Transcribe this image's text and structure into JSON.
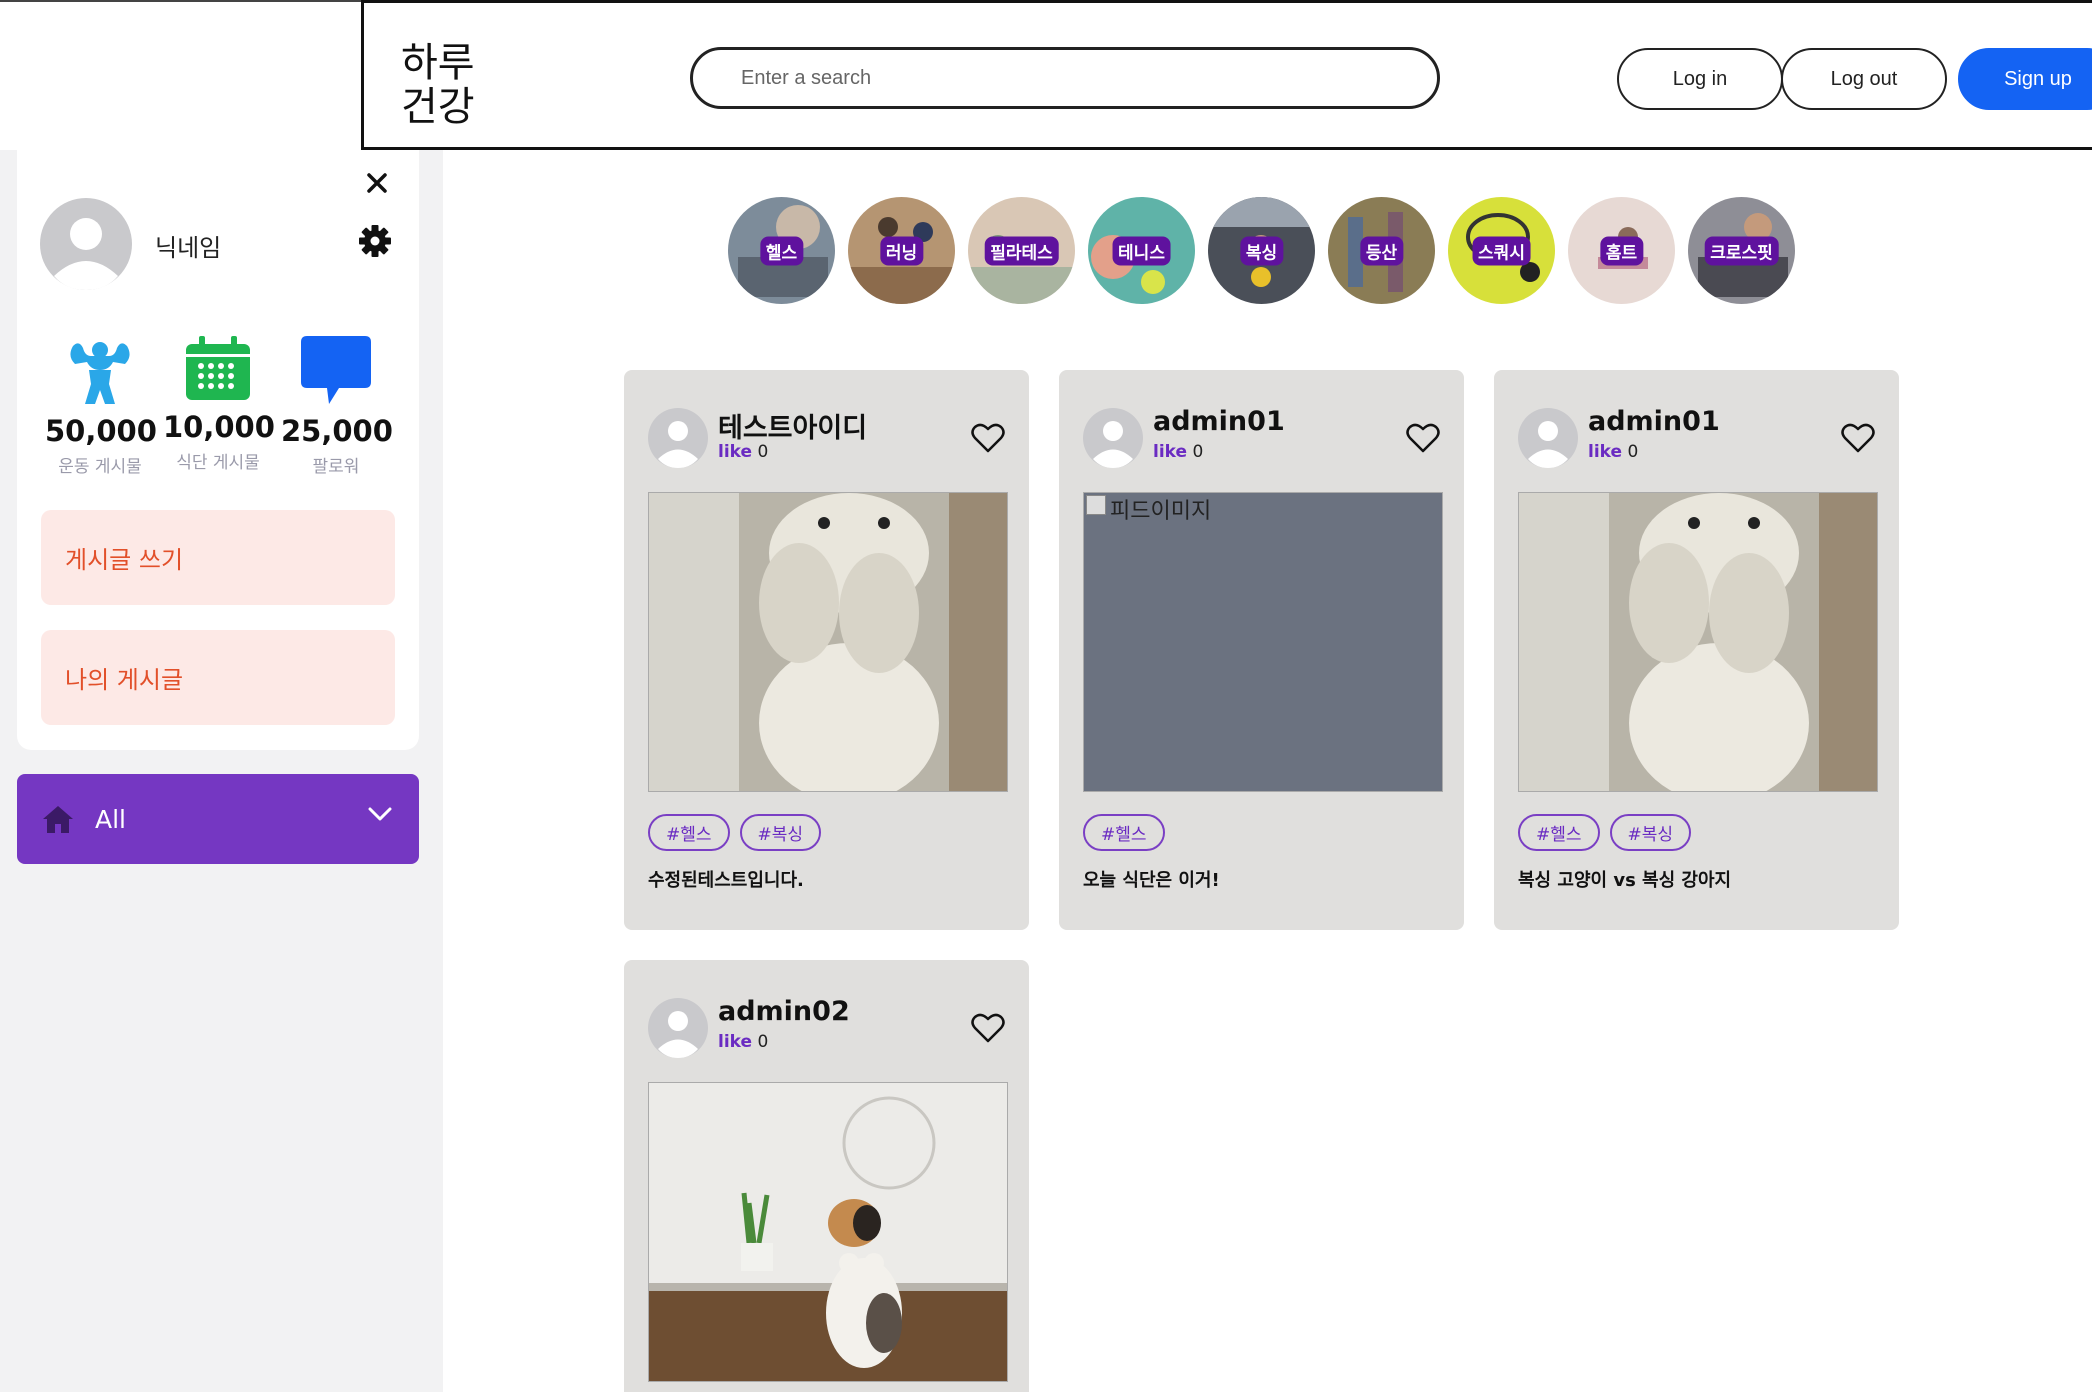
{
  "header": {
    "logo_line1": "하루",
    "logo_line2": "건강",
    "search_placeholder": "Enter a search",
    "login_label": "Log in",
    "logout_label": "Log out",
    "signup_label": "Sign up"
  },
  "profile": {
    "nickname": "닉네임",
    "stats": [
      {
        "value": "50,000",
        "label": "운동 게시물"
      },
      {
        "value": "10,000",
        "label": "식단 게시물"
      },
      {
        "value": "25,000",
        "label": "팔로워"
      }
    ],
    "write_label": "게시글 쓰기",
    "my_posts_label": "나의 게시글"
  },
  "filter": {
    "selected": "All"
  },
  "categories": [
    {
      "label": "헬스",
      "color": "#7d8c9a"
    },
    {
      "label": "러닝",
      "color": "#b59572"
    },
    {
      "label": "필라테스",
      "color": "#d9c7b5"
    },
    {
      "label": "테니스",
      "color": "#5fb3a8"
    },
    {
      "label": "복싱",
      "color": "#4a4f58"
    },
    {
      "label": "등산",
      "color": "#8a7c55"
    },
    {
      "label": "스쿼시",
      "color": "#d7e03a"
    },
    {
      "label": "홈트",
      "color": "#e7d9d4"
    },
    {
      "label": "크로스핏",
      "color": "#8e8e96"
    }
  ],
  "posts": [
    {
      "user": "테스트아이디",
      "like_word": "like",
      "like_count": "0",
      "tags": [
        "#헬스",
        "#복싱"
      ],
      "text": "수정된테스트입니다.",
      "image": "dog"
    },
    {
      "user": "admin01",
      "like_word": "like",
      "like_count": "0",
      "tags": [
        "#헬스"
      ],
      "text": "오늘 식단은 이거!",
      "image": "broken",
      "alt": "피드이미지"
    },
    {
      "user": "admin01",
      "like_word": "like",
      "like_count": "0",
      "tags": [
        "#헬스",
        "#복싱"
      ],
      "text": "복싱 고양이 vs 복싱 강아지",
      "image": "dog"
    },
    {
      "user": "admin02",
      "like_word": "like",
      "like_count": "0",
      "tags": [],
      "text": "",
      "image": "cat"
    }
  ]
}
